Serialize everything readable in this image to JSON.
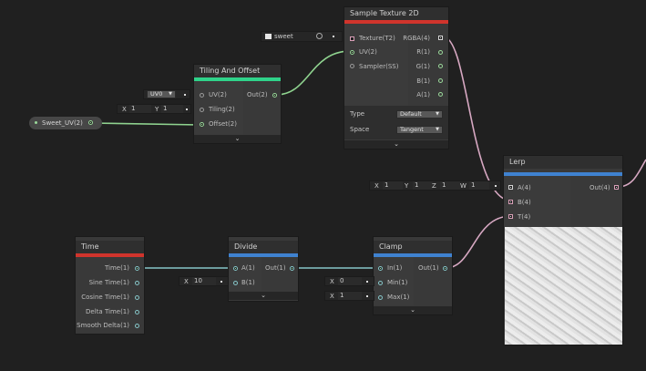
{
  "colors": {
    "background": "#202020",
    "wire_green": "#8fd38f",
    "wire_pink": "#d7a8c2",
    "wire_teal": "#86c6c8",
    "header_red": "#d0342c",
    "header_green": "#2fd38a",
    "header_blue": "#3f82d0"
  },
  "sample_texture": {
    "title": "Sample Texture 2D",
    "texture_field": "sweet",
    "inputs": [
      "Texture(T2)",
      "UV(2)",
      "Sampler(SS)"
    ],
    "outputs": [
      "RGBA(4)",
      "R(1)",
      "G(1)",
      "B(1)",
      "A(1)"
    ],
    "type_label": "Type",
    "type_value": "Default",
    "space_label": "Space",
    "space_value": "Tangent",
    "collapse": "⌄"
  },
  "tiling": {
    "title": "Tiling And Offset",
    "inputs": [
      "UV(2)",
      "Tiling(2)",
      "Offset(2)"
    ],
    "output": "Out(2)",
    "uv_value": "UV0",
    "tiling_x_label": "X",
    "tiling_x": "1",
    "tiling_y_label": "Y",
    "tiling_y": "1",
    "collapse": "⌄"
  },
  "property": {
    "label": "Sweet_UV(2)"
  },
  "lerp": {
    "title": "Lerp",
    "inputs": [
      "A(4)",
      "B(4)",
      "T(4)"
    ],
    "output": "Out(4)",
    "vec": {
      "x_label": "X",
      "x": "1",
      "y_label": "Y",
      "y": "1",
      "z_label": "Z",
      "z": "1",
      "w_label": "W",
      "w": "1"
    }
  },
  "time": {
    "title": "Time",
    "outputs": [
      "Time(1)",
      "Sine Time(1)",
      "Cosine Time(1)",
      "Delta Time(1)",
      "Smooth Delta(1)"
    ]
  },
  "divide": {
    "title": "Divide",
    "inputs": [
      "A(1)",
      "B(1)"
    ],
    "output": "Out(1)",
    "b_label": "X",
    "b_value": "10",
    "collapse": "⌄"
  },
  "clamp": {
    "title": "Clamp",
    "inputs": [
      "In(1)",
      "Min(1)",
      "Max(1)"
    ],
    "output": "Out(1)",
    "min_label": "X",
    "min_value": "0",
    "max_label": "X",
    "max_value": "1",
    "collapse": "⌄"
  }
}
